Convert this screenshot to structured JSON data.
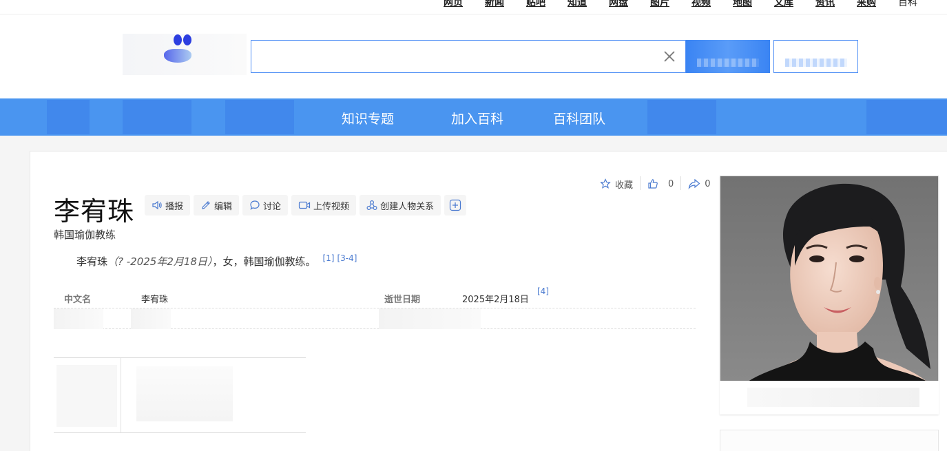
{
  "topnav": {
    "links": [
      "网页",
      "新闻",
      "贴吧",
      "知道",
      "网盘",
      "图片",
      "视频",
      "地图",
      "文库",
      "资讯",
      "采购",
      "百科"
    ]
  },
  "search": {
    "value": "",
    "placeholder": ""
  },
  "bluebar": {
    "items": [
      "知识专题",
      "加入百科",
      "百科团队"
    ]
  },
  "stats": {
    "collect_label": "收藏",
    "like_count": "0",
    "share_count": "0"
  },
  "entry": {
    "title": "李宥珠",
    "subtitle": "韩国瑜伽教练",
    "summary_name": "李宥珠",
    "summary_dates": "（? -2025年2月18日）",
    "summary_rest": "，女，韩国瑜伽教练。",
    "refs": [
      "[1]",
      "[3-4]"
    ]
  },
  "tools": [
    "播报",
    "编辑",
    "讨论",
    "上传视频",
    "创建人物关系"
  ],
  "info": [
    {
      "label": "中文名",
      "value": "李宥珠"
    },
    {
      "label": "逝世日期",
      "value": "2025年2月18日",
      "ref": "[4]"
    }
  ],
  "colors": {
    "accent": "#4a95f0",
    "link": "#4a7ad0",
    "search_border": "#4e8ef5"
  }
}
